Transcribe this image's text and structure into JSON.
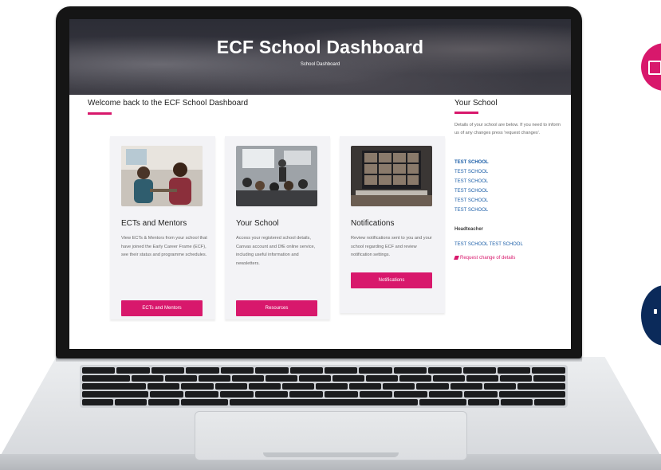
{
  "hero": {
    "title": "ECF School Dashboard",
    "subtitle": "School Dashboard"
  },
  "main": {
    "heading": "Welcome back to the ECF School Dashboard",
    "cards": [
      {
        "image_icon": "ects-mentors-photo",
        "title": "ECTs and Mentors",
        "text": "View ECTs & Mentors from your school that have joined the Early Career Frame (ECF), see their status and programme schedules.",
        "button": "ECTs and Mentors"
      },
      {
        "image_icon": "classroom-photo",
        "title": "Your School",
        "text": "Access your registered school details, Canvas account and DfE online service, including useful information and newsletters.",
        "button": "Resources"
      },
      {
        "image_icon": "video-call-photo",
        "title": "Notifications",
        "text": "Review notifications sent to you and your school regarding ECF and review notification settings.",
        "button": "Notifications"
      }
    ]
  },
  "sidebar": {
    "title": "Your School",
    "description": "Details of your school are below. If you need to inform us of any changes press 'request changes'.",
    "school_lines": [
      "TEST SCHOOL",
      "TEST SCHOOL",
      "TEST SCHOOL",
      "TEST SCHOOL",
      "TEST SCHOOL",
      "TEST SCHOOL"
    ],
    "headteacher_label": "Headteacher",
    "headteacher_name": "TEST SCHOOL TEST SCHOOL",
    "request_link": "Request change of details",
    "request_icon": "pencil-icon"
  },
  "colors": {
    "accent": "#d8186c",
    "link": "#1c5fa8",
    "navy": "#0b2a5a"
  }
}
